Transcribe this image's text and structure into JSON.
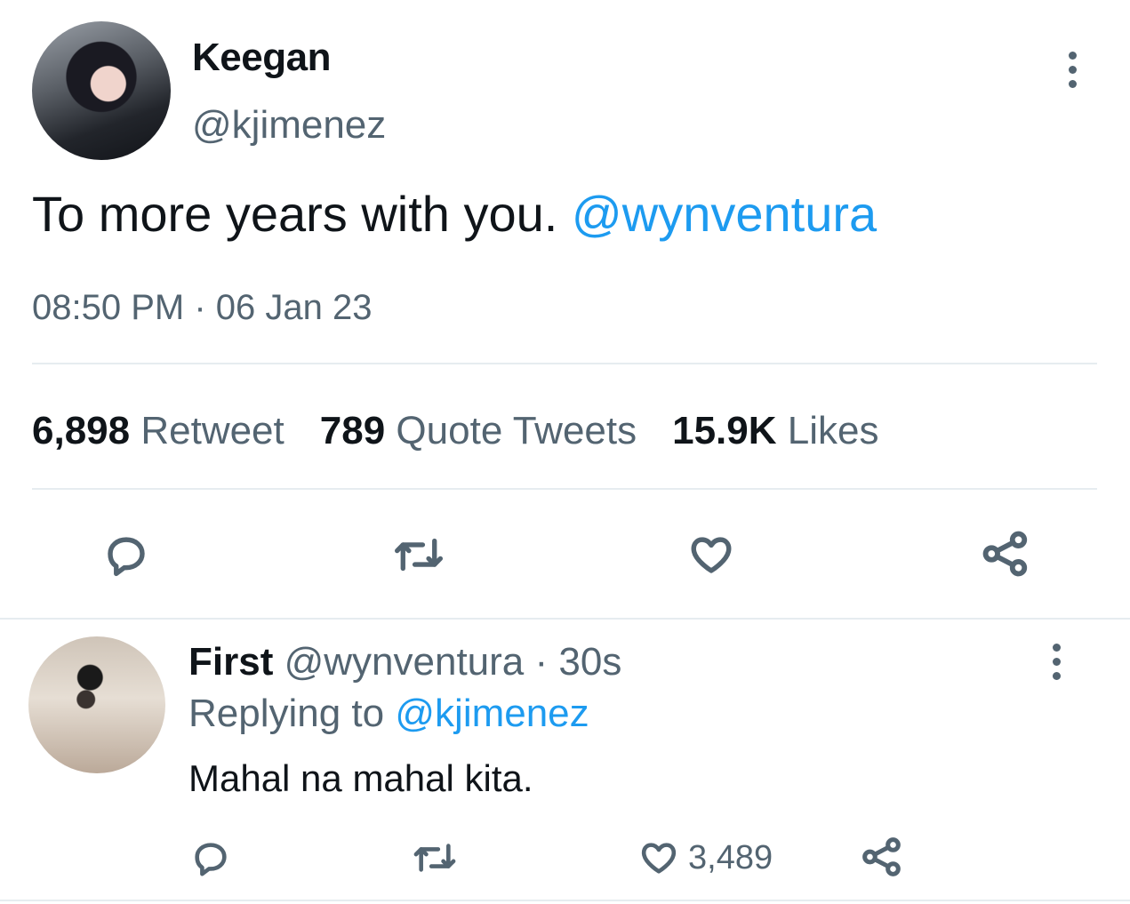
{
  "tweet": {
    "author_name": "Keegan",
    "author_handle": "@kjimenez",
    "text": "To more years with you.",
    "mention": "@wynventura",
    "time": "08:50 PM",
    "date_sep": " · ",
    "date": "06 Jan 23",
    "stats": {
      "retweets": "6,898",
      "retweets_label": "Retweet",
      "quotes": "789",
      "quotes_label": "Quote Tweets",
      "likes": "15.9K",
      "likes_label": "Likes"
    },
    "icons": [
      "reply-icon",
      "retweet-icon",
      "like-icon",
      "share-icon"
    ]
  },
  "reply": {
    "author_name": "First",
    "author_handle": "@wynventura",
    "sep": " · ",
    "age": "30s",
    "replying_to_label": "Replying to",
    "replying_to": "@kjimenez",
    "text": "Mahal na mahal kita.",
    "like_count": "3,489",
    "icons": [
      "reply-icon",
      "retweet-icon",
      "like-icon",
      "share-icon"
    ]
  },
  "colors": {
    "accent": "#1d9bf0",
    "secondary_text": "#536471",
    "primary_text": "#0f1419",
    "divider": "#e6ecf0"
  }
}
